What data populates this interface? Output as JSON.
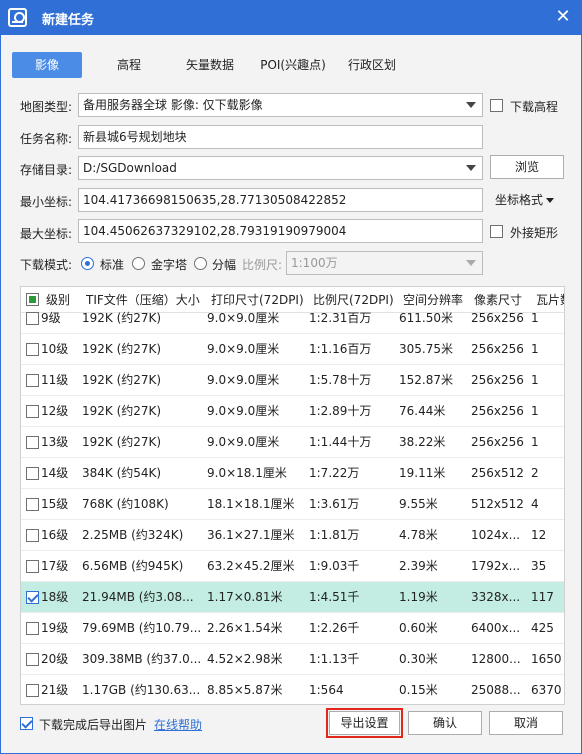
{
  "window": {
    "title": "新建任务",
    "close_glyph": "✕"
  },
  "tabs": [
    {
      "label": "影像",
      "active": true
    },
    {
      "label": "高程",
      "active": false
    },
    {
      "label": "矢量数据",
      "active": false
    },
    {
      "label": "POI(兴趣点)",
      "active": false
    },
    {
      "label": "行政区划",
      "active": false
    }
  ],
  "form": {
    "map_type_label": "地图类型:",
    "map_type_value": "备用服务器全球  影像: 仅下载影像",
    "download_elevation_label": "下载高程",
    "task_name_label": "任务名称:",
    "task_name_value": "新县城6号规划地块",
    "storage_label": "存储目录:",
    "storage_value": "D:/SGDownload",
    "browse_label": "浏览",
    "min_coord_label": "最小坐标:",
    "min_coord_value": "104.41736698150635,28.77130508422852",
    "coord_format_label": "坐标格式",
    "max_coord_label": "最大坐标:",
    "max_coord_value": "104.45062637329102,28.79319190979004",
    "outer_rect_label": "外接矩形",
    "mode_label": "下载模式:",
    "mode_options": [
      "标准",
      "金字塔",
      "分幅"
    ],
    "scale_label": "比例尺:",
    "scale_value": "1:100万"
  },
  "table": {
    "headers": [
      "级别",
      "TIF文件（压缩）大小",
      "打印尺寸(72DPI)",
      "比例尺(72DPI)",
      "空间分辨率",
      "像素尺寸",
      "瓦片数"
    ],
    "rows": [
      {
        "level": "9级",
        "size": "192K (约27K)",
        "print": "9.0×9.0厘米",
        "scale": "1:2.31百万",
        "res": "611.50米",
        "px": "256x256",
        "tiles": "1",
        "checked": false
      },
      {
        "level": "10级",
        "size": "192K (约27K)",
        "print": "9.0×9.0厘米",
        "scale": "1:1.16百万",
        "res": "305.75米",
        "px": "256x256",
        "tiles": "1",
        "checked": false
      },
      {
        "level": "11级",
        "size": "192K (约27K)",
        "print": "9.0×9.0厘米",
        "scale": "1:5.78十万",
        "res": "152.87米",
        "px": "256x256",
        "tiles": "1",
        "checked": false
      },
      {
        "level": "12级",
        "size": "192K (约27K)",
        "print": "9.0×9.0厘米",
        "scale": "1:2.89十万",
        "res": "76.44米",
        "px": "256x256",
        "tiles": "1",
        "checked": false
      },
      {
        "level": "13级",
        "size": "192K (约27K)",
        "print": "9.0×9.0厘米",
        "scale": "1:1.44十万",
        "res": "38.22米",
        "px": "256x256",
        "tiles": "1",
        "checked": false
      },
      {
        "level": "14级",
        "size": "384K (约54K)",
        "print": "9.0×18.1厘米",
        "scale": "1:7.22万",
        "res": "19.11米",
        "px": "256x512",
        "tiles": "2",
        "checked": false
      },
      {
        "level": "15级",
        "size": "768K (约108K)",
        "print": "18.1×18.1厘米",
        "scale": "1:3.61万",
        "res": "9.55米",
        "px": "512x512",
        "tiles": "4",
        "checked": false
      },
      {
        "level": "16级",
        "size": "2.25MB (约324K)",
        "print": "36.1×27.1厘米",
        "scale": "1:1.81万",
        "res": "4.78米",
        "px": "1024x...",
        "tiles": "12",
        "checked": false
      },
      {
        "level": "17级",
        "size": "6.56MB (约945K)",
        "print": "63.2×45.2厘米",
        "scale": "1:9.03千",
        "res": "2.39米",
        "px": "1792x...",
        "tiles": "35",
        "checked": false
      },
      {
        "level": "18级",
        "size": "21.94MB (约3.08...",
        "print": "1.17×0.81米",
        "scale": "1:4.51千",
        "res": "1.19米",
        "px": "3328x...",
        "tiles": "117",
        "checked": true
      },
      {
        "level": "19级",
        "size": "79.69MB (约10.79...",
        "print": "2.26×1.54米",
        "scale": "1:2.26千",
        "res": "0.60米",
        "px": "6400x...",
        "tiles": "425",
        "checked": false
      },
      {
        "level": "20级",
        "size": "309.38MB (约37.0...",
        "print": "4.52×2.98米",
        "scale": "1:1.13千",
        "res": "0.30米",
        "px": "12800...",
        "tiles": "1650",
        "checked": false
      },
      {
        "level": "21级",
        "size": "1.17GB (约130.63...",
        "print": "8.85×5.87米",
        "scale": "1:564",
        "res": "0.15米",
        "px": "25088...",
        "tiles": "6370",
        "checked": false
      }
    ]
  },
  "footer": {
    "export_after_label": "下载完成后导出图片",
    "help_link": "在线帮助",
    "export_settings": "导出设置",
    "ok": "确认",
    "cancel": "取消"
  },
  "colors": {
    "accent": "#2f6fd6",
    "tab_active": "#4b8ce6",
    "row_selected": "#c3ede3",
    "highlight_outline": "#e1261c"
  }
}
